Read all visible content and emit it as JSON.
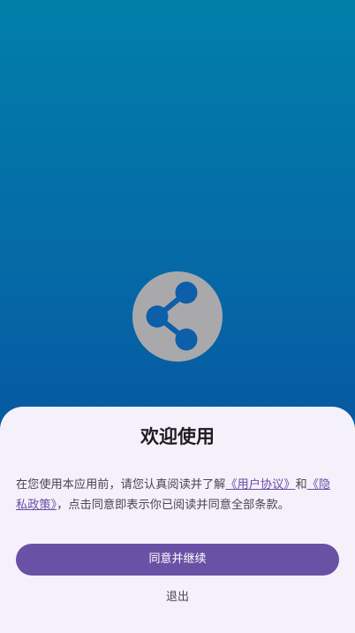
{
  "logo": {
    "icon": "share-icon",
    "circle_color": "#a9a9ac",
    "icon_color": "#0c5fa8"
  },
  "background": {
    "top_color": "#017fa9",
    "bottom_color": "#0653a0"
  },
  "sheet": {
    "title": "欢迎使用",
    "description": {
      "text_before": "在您使用本应用前，请您认真阅读并了解",
      "user_agreement_link": "《用户协议》",
      "joiner": "和",
      "privacy_policy_link": "《隐私政策》",
      "text_after": "，点击同意即表示你已阅读并同意全部条款。"
    },
    "agree_button_label": "同意并继续",
    "exit_button_label": "退出",
    "accent_color": "#6951a5"
  }
}
